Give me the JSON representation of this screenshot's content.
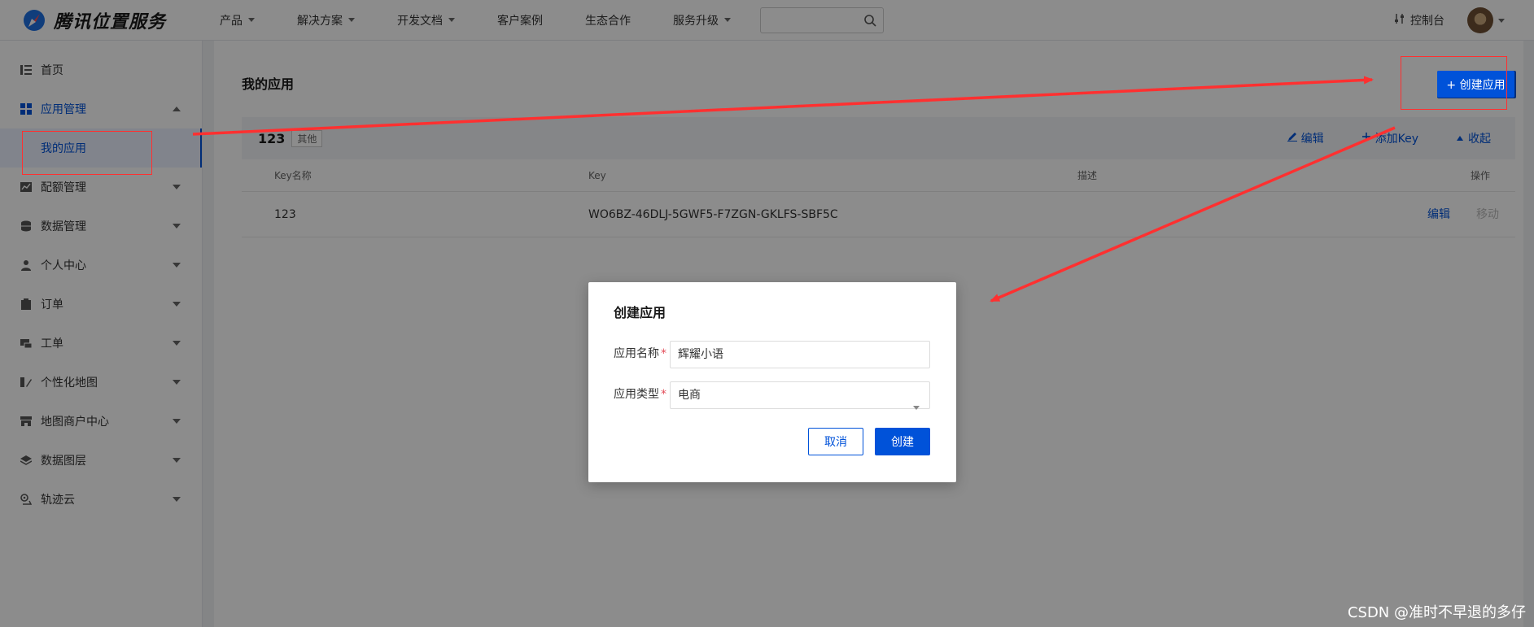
{
  "brand": {
    "name": "腾讯位置服务"
  },
  "nav": {
    "items": [
      {
        "label": "产品",
        "has_menu": true
      },
      {
        "label": "解决方案",
        "has_menu": true
      },
      {
        "label": "开发文档",
        "has_menu": true
      },
      {
        "label": "客户案例",
        "has_menu": false
      },
      {
        "label": "生态合作",
        "has_menu": false
      },
      {
        "label": "服务升级",
        "has_menu": true
      }
    ],
    "search_placeholder": "",
    "console_label": "控制台"
  },
  "sidebar": {
    "items": [
      {
        "label": "首页",
        "icon": "list-icon"
      },
      {
        "label": "应用管理",
        "icon": "grid-icon",
        "expanded": true
      },
      {
        "label": "配额管理",
        "icon": "chart-icon"
      },
      {
        "label": "数据管理",
        "icon": "database-icon"
      },
      {
        "label": "个人中心",
        "icon": "user-icon"
      },
      {
        "label": "订单",
        "icon": "clipboard-icon"
      },
      {
        "label": "工单",
        "icon": "ticket-icon"
      },
      {
        "label": "个性化地图",
        "icon": "map-edit-icon"
      },
      {
        "label": "地图商户中心",
        "icon": "store-icon"
      },
      {
        "label": "数据图层",
        "icon": "layers-icon"
      },
      {
        "label": "轨迹云",
        "icon": "track-icon"
      }
    ],
    "sub_item": "我的应用"
  },
  "main": {
    "title": "我的应用",
    "create_button": "+ 创建应用",
    "app": {
      "name": "123",
      "tag": "其他"
    },
    "actions": {
      "edit": "编辑",
      "add_key": "添加Key",
      "collapse": "收起"
    },
    "table": {
      "headers": [
        "Key名称",
        "Key",
        "描述",
        "操作"
      ],
      "rows": [
        {
          "name": "123",
          "key": "WO6BZ-46DLJ-5GWF5-F7ZGN-GKLFS-SBF5C",
          "desc": "",
          "edit": "编辑",
          "move": "移动"
        }
      ]
    }
  },
  "dialog": {
    "title": "创建应用",
    "name_label": "应用名称",
    "name_value": "辉耀小语",
    "type_label": "应用类型",
    "type_value": "电商",
    "required_mark": "*",
    "cancel": "取消",
    "create": "创建"
  },
  "watermark": "CSDN @准时不早退的多仔",
  "colors": {
    "primary": "#0052d9",
    "annotation": "#ff3030",
    "mask": "rgba(0,0,0,0.45)"
  }
}
